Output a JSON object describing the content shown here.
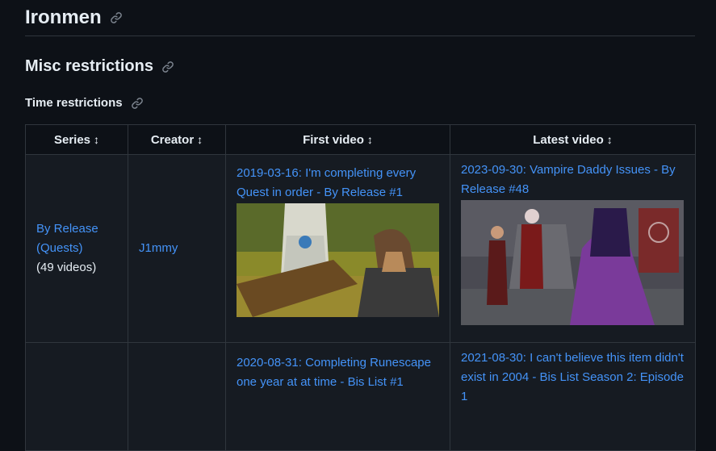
{
  "headings": {
    "ironmen": "Ironmen",
    "misc": "Misc restrictions",
    "time": "Time restrictions"
  },
  "table": {
    "columns": [
      "Series",
      "Creator",
      "First video",
      "Latest video"
    ],
    "sort_icon": "sort-arrows-icon",
    "rows": [
      {
        "series_link": "By Release (Quests)",
        "series_count": "(49 videos)",
        "creator": "J1mmy",
        "first_video": "2019-03-16: I'm completing every Quest in order - By Release #1",
        "latest_video": "2023-09-30: Vampire Daddy Issues - By Release #48"
      },
      {
        "series_link": "",
        "series_count": "",
        "creator": "",
        "first_video": "2020-08-31: Completing Runescape one year at at time - Bis List #1",
        "latest_video": "2021-08-30: I can't believe this item didn't exist in 2004 - Bis List Season 2: Episode 1"
      }
    ]
  },
  "colors": {
    "background": "#0d1117",
    "cell": "#161b22",
    "border": "#30363d",
    "link": "#4493f8",
    "text": "#e6edf3"
  }
}
